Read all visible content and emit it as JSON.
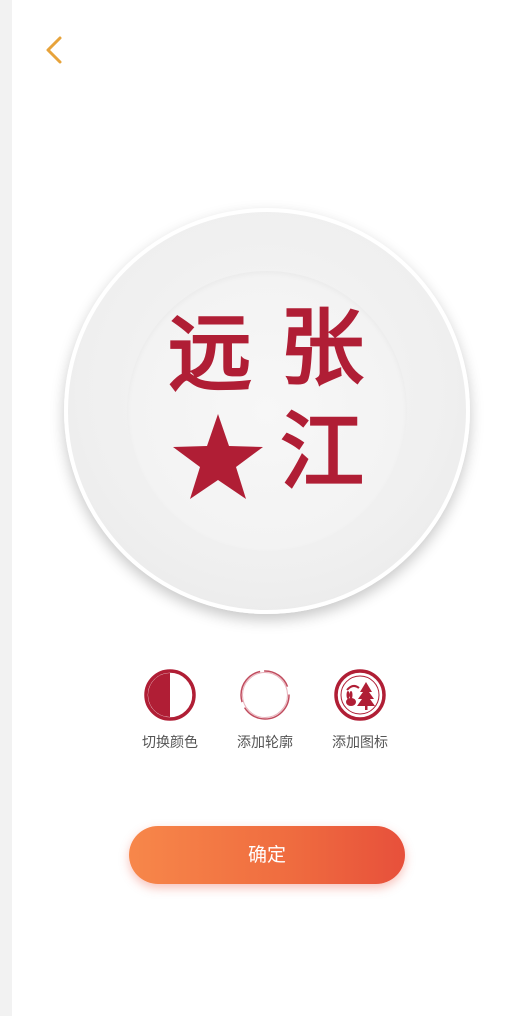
{
  "stamp": {
    "chars": [
      "远",
      "张",
      "江"
    ],
    "color": "#b01e35"
  },
  "tools": [
    {
      "label": "切换颜色",
      "icon": "half-circle-icon"
    },
    {
      "label": "添加轮廓",
      "icon": "outline-circle-icon"
    },
    {
      "label": "添加图标",
      "icon": "rabbit-tree-icon"
    }
  ],
  "confirm": {
    "label": "确定"
  },
  "colors": {
    "accent": "#e7a33b",
    "stamp": "#b01e35",
    "button_start": "#f7874a",
    "button_end": "#e7503b"
  }
}
